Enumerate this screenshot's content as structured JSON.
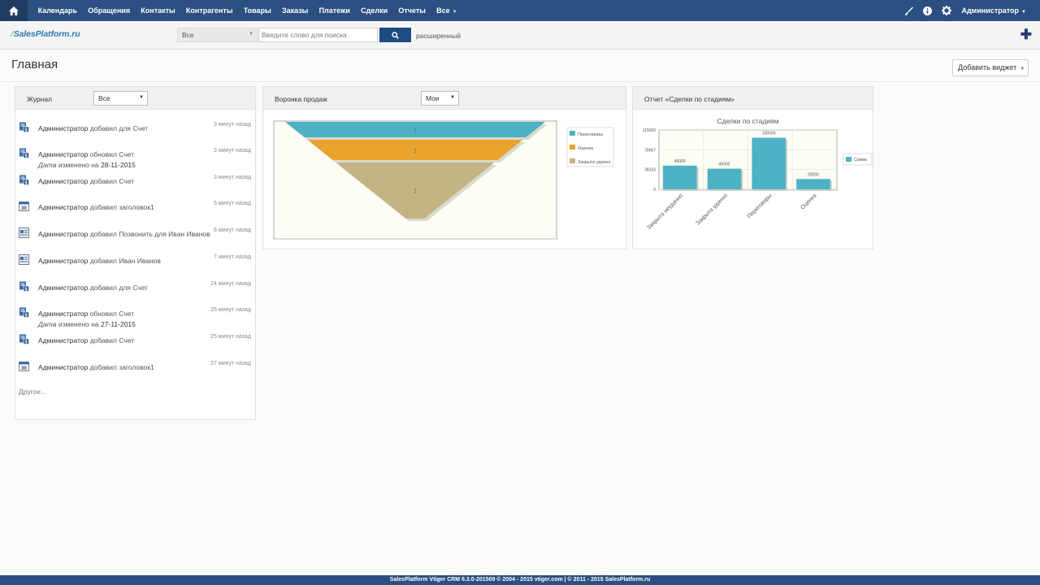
{
  "topnav": {
    "items": [
      "Календарь",
      "Обращения",
      "Контакты",
      "Контрагенты",
      "Товары",
      "Заказы",
      "Платежи",
      "Сделки",
      "Отчеты",
      "Все"
    ],
    "user": "Администратор"
  },
  "searchbar": {
    "logo": "SalesPlatform.ru",
    "scope": "Все",
    "placeholder": "Введите слово для поиска",
    "advanced": "расширенный"
  },
  "page": {
    "title": "Главная",
    "add_widget": "Добавить виджет"
  },
  "journal": {
    "title": "Журнал",
    "filter": "Все",
    "more": "Другое...",
    "items": [
      {
        "icon": "invoice-icon",
        "user": "Администратор",
        "action": "добавил для Счет",
        "time": "3 минут назад"
      },
      {
        "icon": "invoice-icon",
        "user": "Администратор",
        "action": "обновил Счет",
        "field": "Дата",
        "changed": "изменено на",
        "value": "28-11-2015",
        "time": "3 минут назад"
      },
      {
        "icon": "invoice-icon",
        "user": "Администратор",
        "action": "добавил Счет",
        "time": "3 минут назад"
      },
      {
        "icon": "calendar-icon",
        "user": "Администратор",
        "action": "добавил заголовок1",
        "time": "5 минут назад"
      },
      {
        "icon": "contact-icon",
        "user": "Администратор",
        "action": "добавил Позвонить для Иван Иванов",
        "time": "6 минут назад"
      },
      {
        "icon": "contact-icon",
        "user": "Администратор",
        "action": "добавил Иван Иванов",
        "time": "7 минут назад"
      },
      {
        "icon": "invoice-icon",
        "user": "Администратор",
        "action": "добавил для Счет",
        "time": "24 минут назад"
      },
      {
        "icon": "invoice-icon",
        "user": "Администратор",
        "action": "обновил Счет",
        "field": "Дата",
        "changed": "изменено на",
        "value": "27-11-2015",
        "time": "25 минут назад"
      },
      {
        "icon": "invoice-icon",
        "user": "Администратор",
        "action": "добавил Счет",
        "time": "25 минут назад"
      },
      {
        "icon": "calendar-icon",
        "user": "Администратор",
        "action": "добавил заголовок1",
        "time": "27 минут назад"
      }
    ]
  },
  "funnel": {
    "title": "Воронка продаж",
    "filter": "Мои"
  },
  "report": {
    "title": "Отчет «Сделки по стадиям»"
  },
  "chart_data": [
    {
      "type": "funnel",
      "stages": [
        "Переговоры",
        "Оценка",
        "Закрыта удачно"
      ],
      "values": [
        1,
        1,
        1
      ],
      "colors": [
        "#4db3c4",
        "#e8a42c",
        "#c4b483"
      ],
      "legend": [
        "Переговоры",
        "Оценка",
        "Закрыта удачно"
      ]
    },
    {
      "type": "bar",
      "title": "Сделки по стадиям",
      "categories": [
        "Закрыта неудачно",
        "Закрыта удачно",
        "Переговоры",
        "Оценка"
      ],
      "values": [
        46000,
        40000,
        100000,
        20000
      ],
      "series_name": "Сумма",
      "ylim": [
        0,
        115000
      ],
      "yticks": [
        "115000",
        "76667",
        "38333",
        "0"
      ],
      "color": "#4db3c4",
      "grid": true,
      "legend": "right"
    }
  ],
  "footer": {
    "text": "SalesPlatform Vtiger CRM 6.3.0-201509  © 2004 - 2015  vtiger.com | © 2011 - 2015  SalesPlatform.ru"
  }
}
